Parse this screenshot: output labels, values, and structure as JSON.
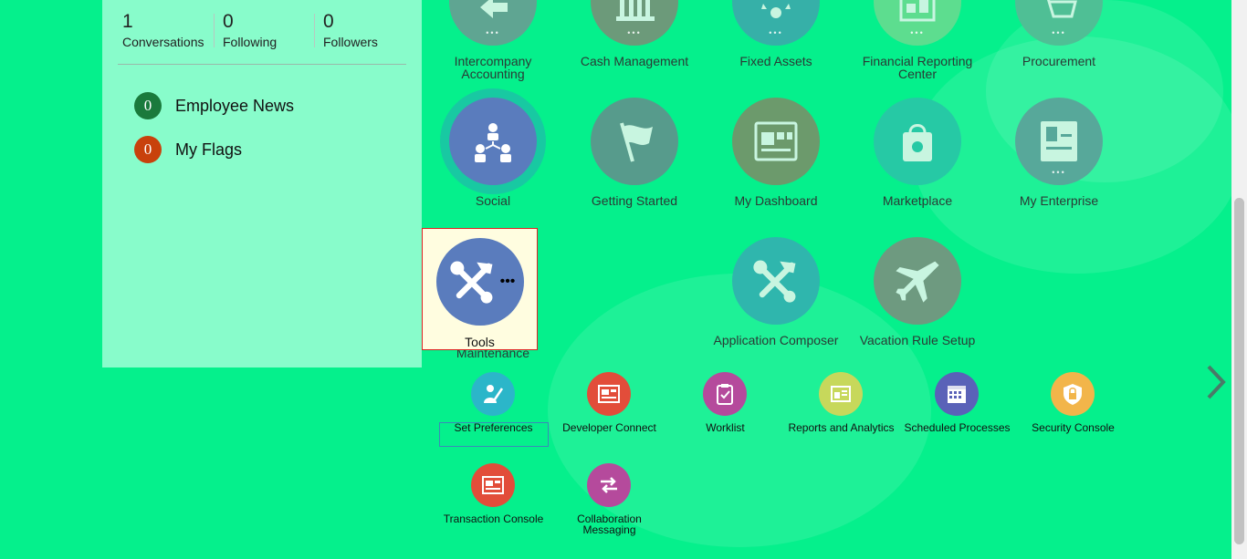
{
  "profile": {
    "stats": [
      {
        "count": "1",
        "label": "Conversations"
      },
      {
        "count": "0",
        "label": "Following"
      },
      {
        "count": "0",
        "label": "Followers"
      }
    ],
    "news": [
      {
        "count": "0",
        "label": "Employee News",
        "color": "#1a7a3c"
      },
      {
        "count": "0",
        "label": "My Flags",
        "color": "#c8410c"
      }
    ]
  },
  "apps_row1": [
    {
      "label": "Intercompany Accounting",
      "color": "#5fa592",
      "icon": "arrow-left-icon"
    },
    {
      "label": "Cash Management",
      "color": "#6c9a7a",
      "icon": "bank-icon"
    },
    {
      "label": "Fixed Assets",
      "color": "#36b0a8",
      "icon": "gear-cycle-icon"
    },
    {
      "label": "Financial Reporting Center",
      "color": "#5ddd8f",
      "icon": "report-icon"
    },
    {
      "label": "Procurement",
      "color": "#4fbf95",
      "icon": "cart-icon"
    }
  ],
  "apps_row2": [
    {
      "label": "Social",
      "color": "#5a7cbd",
      "icon": "org-chart-icon"
    },
    {
      "label": "Getting Started",
      "color": "#579b8c",
      "icon": "flag-icon"
    },
    {
      "label": "My Dashboard",
      "color": "#6c9a6c",
      "icon": "dashboard-icon"
    },
    {
      "label": "Marketplace",
      "color": "#26c9a5",
      "icon": "shopping-bag-icon"
    },
    {
      "label": "My Enterprise",
      "color": "#57a89a",
      "icon": "building-icon"
    }
  ],
  "apps_row3": [
    {
      "label": "Tools",
      "hidden_label": "Maintenance",
      "color": "#5a7cbd",
      "icon": "tools-icon"
    },
    {
      "label": "Application Composer",
      "color": "#2fb6ad",
      "icon": "tools-icon"
    },
    {
      "label": "Vacation Rule Setup",
      "color": "#6e9a80",
      "icon": "airplane-icon"
    }
  ],
  "quick_links": [
    {
      "label": "Set Preferences",
      "color": "#2bb6c9",
      "icon": "user-edit-icon"
    },
    {
      "label": "Developer Connect",
      "color": "#e24d3a",
      "icon": "console-icon"
    },
    {
      "label": "Worklist",
      "color": "#b54a9c",
      "icon": "clipboard-check-icon"
    },
    {
      "label": "Reports and Analytics",
      "color": "#c7d85b",
      "icon": "report-icon"
    },
    {
      "label": "Scheduled Processes",
      "color": "#5a62b8",
      "icon": "calendar-icon"
    },
    {
      "label": "Security Console",
      "color": "#f2b54a",
      "icon": "shield-lock-icon"
    },
    {
      "label": "Transaction Console",
      "color": "#e24d3a",
      "icon": "console-icon"
    },
    {
      "label": "Collaboration Messaging",
      "color": "#b54a9c",
      "icon": "swap-arrows-icon"
    }
  ],
  "dots": "•••"
}
